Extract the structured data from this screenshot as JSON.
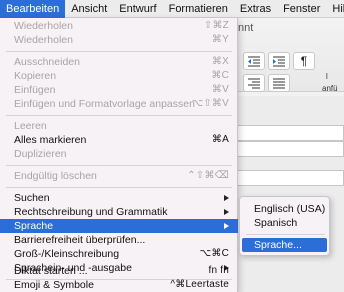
{
  "menubar": {
    "items": [
      {
        "label": "Bearbeiten",
        "active": true
      },
      {
        "label": "Ansicht"
      },
      {
        "label": "Entwurf"
      },
      {
        "label": "Formatieren"
      },
      {
        "label": "Extras"
      },
      {
        "label": "Fenster"
      },
      {
        "label": "Hilfe"
      }
    ]
  },
  "background": {
    "title_fragment": "nnt",
    "side_label_top": "l",
    "side_label": "anfü",
    "pilcrow": "¶"
  },
  "edit_menu": {
    "items": [
      {
        "label": "Wiederholen",
        "shortcut": "⇧⌘Z",
        "disabled": true
      },
      {
        "label": "Wiederholen",
        "shortcut": "⌘Y",
        "disabled": true
      },
      {
        "label": "Ausschneiden",
        "shortcut": "⌘X",
        "disabled": true
      },
      {
        "label": "Kopieren",
        "shortcut": "⌘C",
        "disabled": true
      },
      {
        "label": "Einfügen",
        "shortcut": "⌘V",
        "disabled": true
      },
      {
        "label": "Einfügen und Formatvorlage anpassen",
        "shortcut": "⌥⇧⌘V",
        "disabled": true
      },
      {
        "label": "Leeren",
        "disabled": true
      },
      {
        "label": "Alles markieren",
        "shortcut": "⌘A"
      },
      {
        "label": "Duplizieren",
        "disabled": true
      },
      {
        "label": "Endgültig löschen",
        "shortcut": "⌃⇧⌘⌫",
        "disabled": true
      },
      {
        "label": "Suchen",
        "submenu": true
      },
      {
        "label": "Rechtschreibung und Grammatik",
        "submenu": true
      },
      {
        "label": "Sprache",
        "submenu": true,
        "highlighted": true
      },
      {
        "label": "Barrierefreiheit überprüfen..."
      },
      {
        "label": "Groß-/Kleinschreibung",
        "shortcut": "⌥⌘C"
      },
      {
        "label": "Sprachein- und -ausgabe",
        "submenu": true
      },
      {
        "label": "Diktat starten ...",
        "shortcut": "fn fn"
      },
      {
        "label": "Emoji & Symbole",
        "shortcut": "^⌘Leertaste"
      }
    ]
  },
  "language_submenu": {
    "items": [
      {
        "label": "Englisch (USA)"
      },
      {
        "label": "Spanisch"
      },
      {
        "label": "Sprache...",
        "highlighted": true
      }
    ]
  },
  "colors": {
    "accent": "#2c6ed8",
    "menu_bg": "#f6f2f5",
    "disabled_text": "#a8a4a8"
  }
}
